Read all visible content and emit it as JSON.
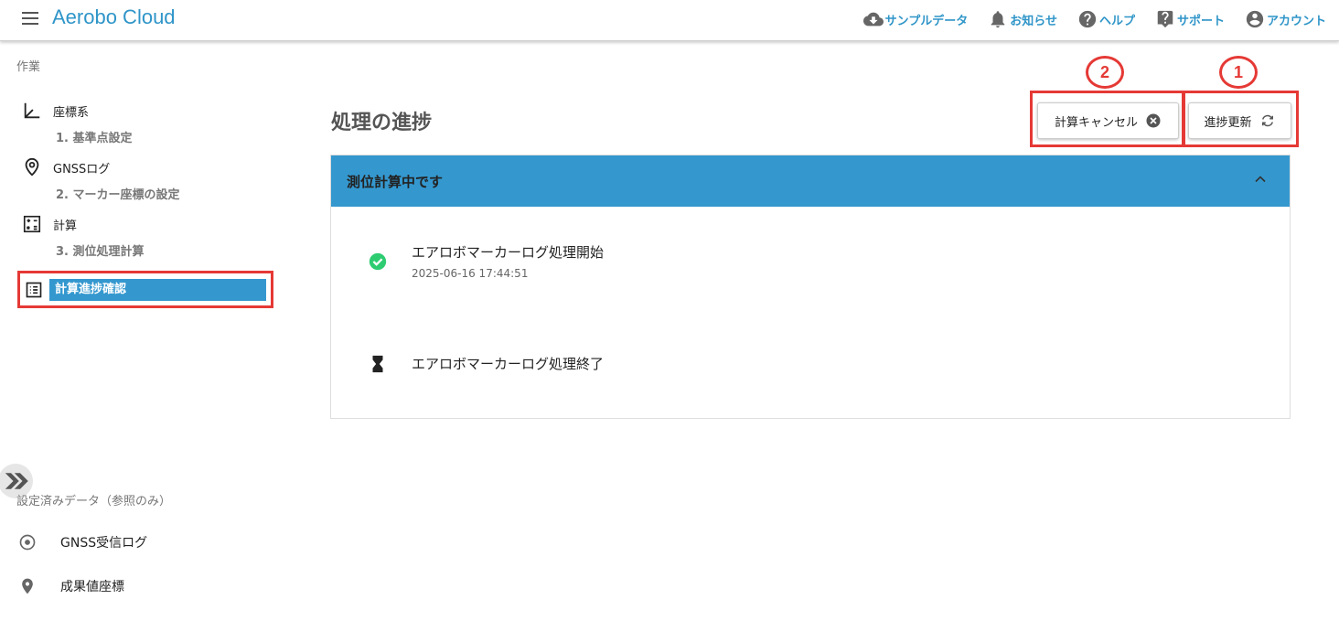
{
  "app": {
    "title": "Aerobo Cloud"
  },
  "topnav": [
    {
      "label": "サンプルデータ",
      "icon": "cloud-download-icon"
    },
    {
      "label": "お知らせ",
      "icon": "bell-icon"
    },
    {
      "label": "ヘルプ",
      "icon": "help-circle-icon"
    },
    {
      "label": "サポート",
      "icon": "support-icon"
    },
    {
      "label": "アカウント",
      "icon": "account-icon"
    }
  ],
  "sidebar": {
    "work_label": "作業",
    "items": [
      {
        "label": "座標系",
        "sub": "1. 基準点設定",
        "icon": "axis-icon"
      },
      {
        "label": "GNSSログ",
        "sub": "2. マーカー座標の設定",
        "icon": "location-icon"
      },
      {
        "label": "計算",
        "sub": "3. 測位処理計算",
        "icon": "calculator-icon"
      },
      {
        "label": "計算進捗確認",
        "icon": "list-icon",
        "active": true
      }
    ],
    "reference_label": "設定済みデータ（参照のみ）",
    "reference_items": [
      {
        "label": "GNSS受信ログ",
        "icon": "radio-target-icon"
      },
      {
        "label": "成果値座標",
        "icon": "map-pin-icon"
      }
    ]
  },
  "main": {
    "title": "処理の進捗",
    "cancel_button": "計算キャンセル",
    "refresh_button": "進捗更新",
    "markers": [
      "2",
      "1"
    ],
    "panel_title": "測位計算中です",
    "steps": [
      {
        "title": "エアロボマーカーログ処理開始",
        "time": "2025-06-16 17:44:51",
        "status": "done"
      },
      {
        "title": "エアロボマーカーログ処理終了",
        "time": "",
        "status": "pending"
      }
    ]
  },
  "colors": {
    "accent": "#3498cf",
    "brand": "#2f95c8",
    "highlight": "#e53935",
    "success": "#2ecc71"
  }
}
